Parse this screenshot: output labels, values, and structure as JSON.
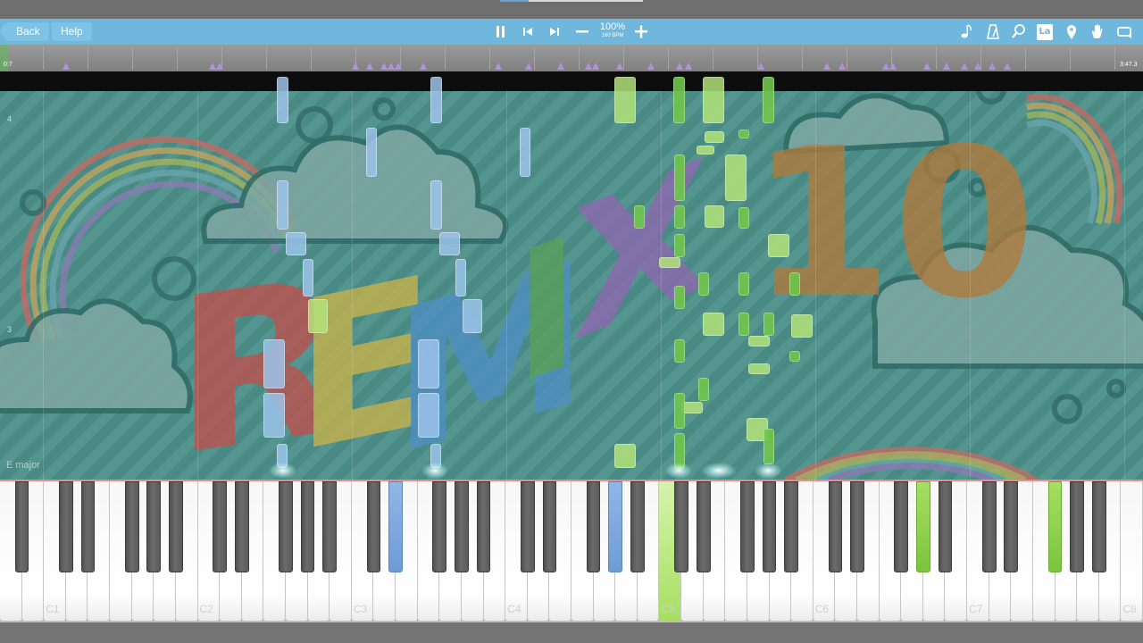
{
  "toolbar": {
    "back_label": "Back",
    "help_label": "Help",
    "tempo_percent": "100%",
    "tempo_bpm": "160 BPM",
    "la_label": "La"
  },
  "timeline": {
    "start_time": "0:7",
    "end_time": "3:47.3"
  },
  "measures": [
    "4",
    "3"
  ],
  "key_signature": "E major",
  "octave_labels": [
    "C1",
    "C2",
    "C3",
    "C4",
    "C5",
    "C6",
    "C7",
    "C8"
  ],
  "colors": {
    "toolbar": "#6fb7dd",
    "left_hand_notes": "#9cc3ea",
    "right_hand_notes": "#b3e27a",
    "marker": "#b48ee0"
  },
  "icons": [
    "pause-icon",
    "skip-back-icon",
    "skip-forward-icon",
    "minus-icon",
    "plus-icon",
    "note-icon",
    "metronome-icon",
    "zoom-icon",
    "note-label-icon",
    "pin-icon",
    "hand-icon",
    "loop-icon"
  ]
}
